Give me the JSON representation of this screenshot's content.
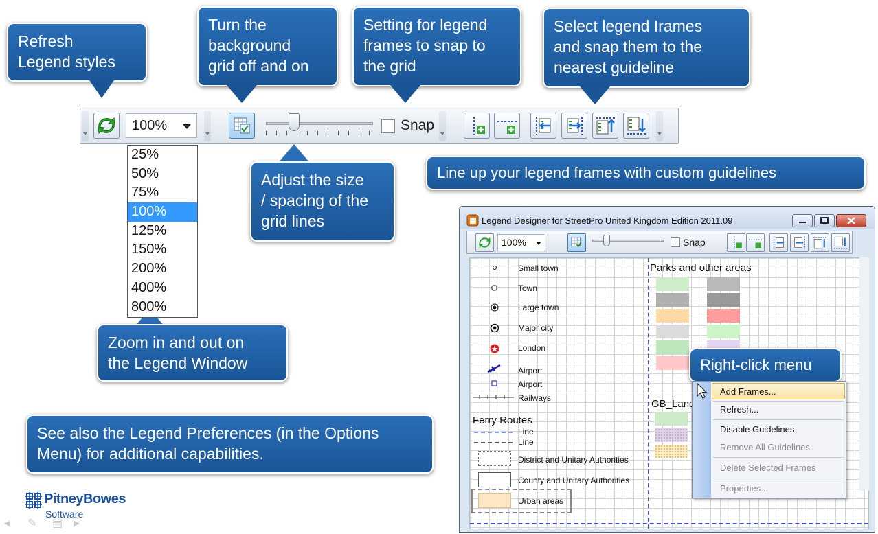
{
  "callouts": {
    "refresh": "Refresh\nLegend styles",
    "grid_toggle": "Turn the\nbackground\ngrid off and on",
    "snap_setting": "Setting for legend\nframes to snap to\nthe grid",
    "select_frames": "Select legend Irames\nand snap them to the\nnearest guideline",
    "guidelines": "Line up your legend frames with custom guidelines",
    "grid_size": "Adjust the size\n/ spacing of the\ngrid lines",
    "zoom": "Zoom in and out on\nthe Legend Window",
    "preferences": "See also the Legend Preferences (in the Options\nMenu) for additional capabilities.",
    "right_click": "Right-click menu"
  },
  "toolbar": {
    "zoom_value": "100%",
    "snap_label": "Snap",
    "snap_checked": false,
    "grid_on": true,
    "slider_level": 0.26
  },
  "zoom_options": [
    "25%",
    "50%",
    "75%",
    "100%",
    "125%",
    "150%",
    "200%",
    "400%",
    "800%"
  ],
  "zoom_selected": "100%",
  "window": {
    "title": "Legend Designer for StreetPro United Kingdom Edition 2011.09",
    "zoom_value": "100%",
    "snap_label": "Snap"
  },
  "legend": {
    "points": [
      "Small town",
      "Town",
      "Large town",
      "Major city",
      "London",
      "Airport",
      "Airport",
      "Railways"
    ],
    "ferry_heading": "Ferry Routes",
    "ferry_lines": [
      "Line",
      "Line"
    ],
    "areas": [
      "District and Unitary Authorities",
      "County and Unitary Authorities",
      "Urban areas"
    ],
    "parks_heading": "Parks and other areas",
    "gb_heading": "GB_Land"
  },
  "context_menu": {
    "items": [
      {
        "label": "Add Frames...",
        "enabled": true
      },
      {
        "label": "Refresh...",
        "enabled": true
      },
      {
        "label": "Disable Guidelines",
        "enabled": true
      },
      {
        "label": "Remove All Guidelines",
        "enabled": false
      },
      {
        "label": "Delete Selected Frames",
        "enabled": false
      },
      {
        "label": "Properties...",
        "enabled": false
      }
    ]
  },
  "footer": {
    "brand": "PitneyBowes",
    "sub": "Software"
  },
  "colors": {
    "callout_blue": "#1e5fa3",
    "selection_blue": "#3399ff",
    "guideline_blue": "#4455cc",
    "brand_blue": "#1a4f9c"
  }
}
